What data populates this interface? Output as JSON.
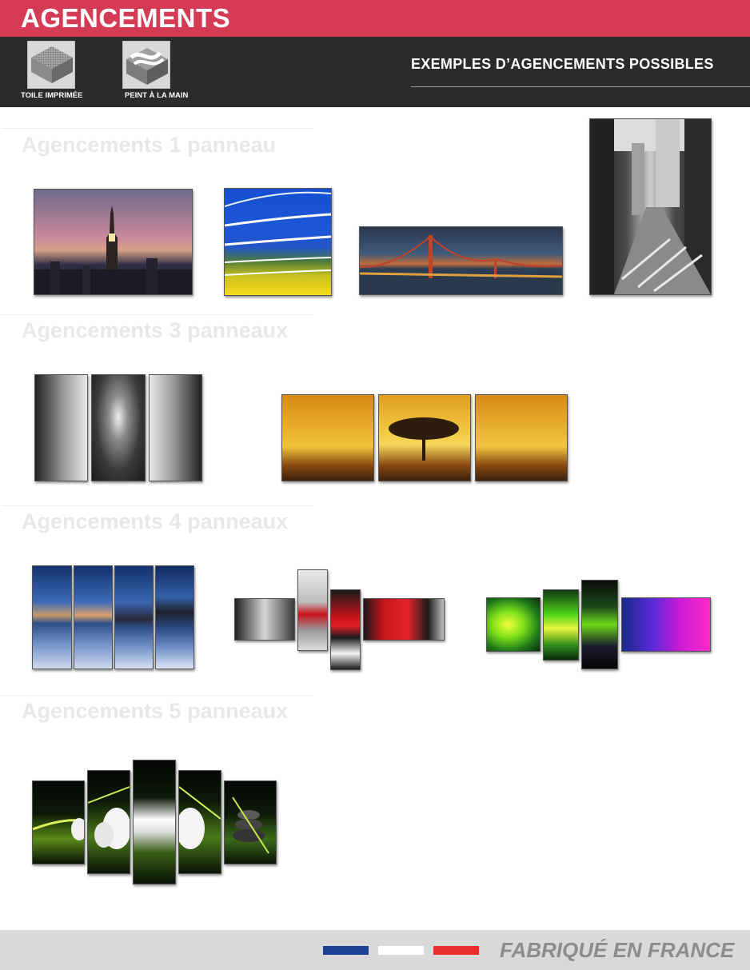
{
  "header": {
    "title": "AGENCEMENTS",
    "icons": [
      {
        "name": "printed-canvas-icon",
        "label": "TOILE IMPRIMÉE"
      },
      {
        "name": "hand-painted-icon",
        "label": "PEINT À LA MAIN"
      }
    ],
    "heading": "EXEMPLES D’AGENCEMENTS POSSIBLES"
  },
  "sections": [
    {
      "title": "Agencements 1 panneau"
    },
    {
      "title": "Agencements 3 panneaux"
    },
    {
      "title": "Agencements 4 panneaux"
    },
    {
      "title": "Agencements 5 panneaux"
    }
  ],
  "colors": {
    "accent": "#d63b56",
    "dark_band": "#2b2b2b",
    "flag_blue": "#1d3f94",
    "flag_white": "#ffffff",
    "flag_red": "#e8312e"
  },
  "footer": {
    "text": "FABRIQUÉ EN FRANCE"
  }
}
